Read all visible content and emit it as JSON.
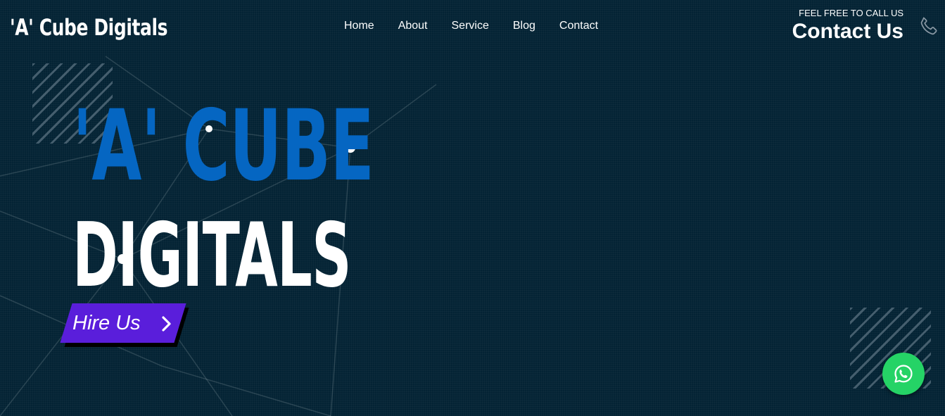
{
  "header": {
    "logo_text": "'A' Cube Digitals",
    "nav_items": [
      {
        "label": "Home"
      },
      {
        "label": "About"
      },
      {
        "label": "Service"
      },
      {
        "label": "Blog"
      },
      {
        "label": "Contact"
      }
    ],
    "call_label": "FEEL FREE TO CALL US",
    "contact_label": "Contact Us",
    "phone_icon": "phone-icon"
  },
  "hero": {
    "line1": "'A' CUBE",
    "line2": "DIGITALS",
    "cta_label": "Hire Us",
    "cta_icon": "chevron-right-icon"
  },
  "floating": {
    "whatsapp_icon": "whatsapp-icon"
  },
  "colors": {
    "background": "#032334",
    "accent_blue": "#0566c2",
    "cta_purple": "#5a1edb",
    "whatsapp_green": "#25d366",
    "text": "#ffffff"
  }
}
